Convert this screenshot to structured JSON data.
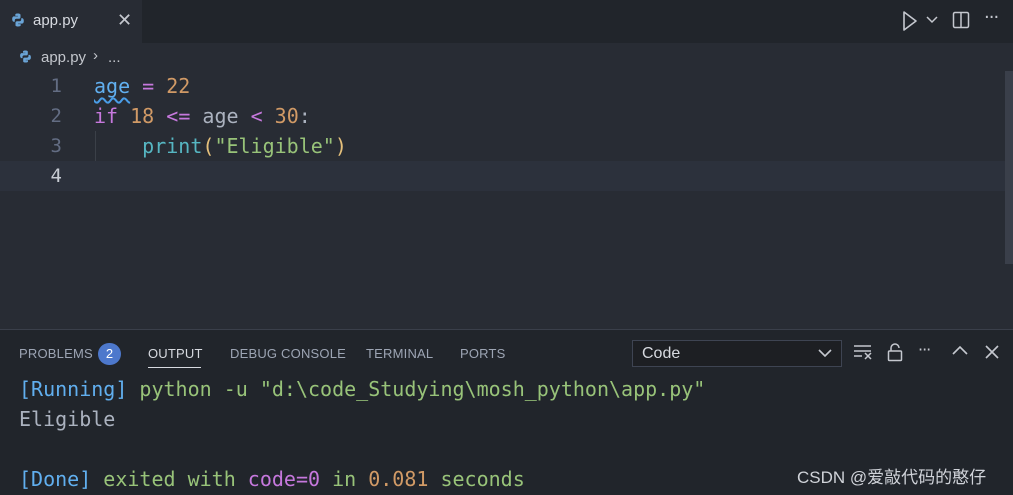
{
  "tabs": [
    {
      "label": "app.py",
      "close": "✕"
    }
  ],
  "toolbar": {
    "more": "···"
  },
  "breadcrumb": {
    "file": "app.py",
    "separator": "›",
    "more": "..."
  },
  "editor": {
    "lines": [
      {
        "number": "1",
        "tokens": {
          "var": "age",
          "op": " = ",
          "num": "22"
        }
      },
      {
        "number": "2",
        "tokens": {
          "kw": "if",
          "sp1": " ",
          "num1": "18",
          "op1": " <= ",
          "var": "age",
          "op2": " < ",
          "num2": "30",
          "colon": ":"
        }
      },
      {
        "number": "3",
        "tokens": {
          "indent": "    ",
          "fn": "print",
          "lp": "(",
          "str": "\"Eligible\"",
          "rp": ")"
        }
      },
      {
        "number": "4",
        "tokens": {}
      }
    ]
  },
  "panel": {
    "tabs": {
      "problems": "PROBLEMS",
      "problems_count": "2",
      "output": "OUTPUT",
      "debug_console": "DEBUG CONSOLE",
      "terminal": "TERMINAL",
      "ports": "PORTS"
    },
    "output_channel": "Code",
    "more": "···",
    "output": {
      "running_tag": "[Running]",
      "command": " python -u \"d:\\code_Studying\\mosh_python\\app.py\"",
      "result": "Eligible",
      "done_tag": "[Done]",
      "done_text1": " exited with ",
      "done_code": "code=0",
      "done_text2": " in ",
      "done_time": "0.081",
      "done_text3": " seconds"
    }
  },
  "watermark": "CSDN @爱敲代码的憨仔",
  "colors": {
    "accent": "#4d78cc",
    "background": "#282c34",
    "panel": "#21252b"
  }
}
